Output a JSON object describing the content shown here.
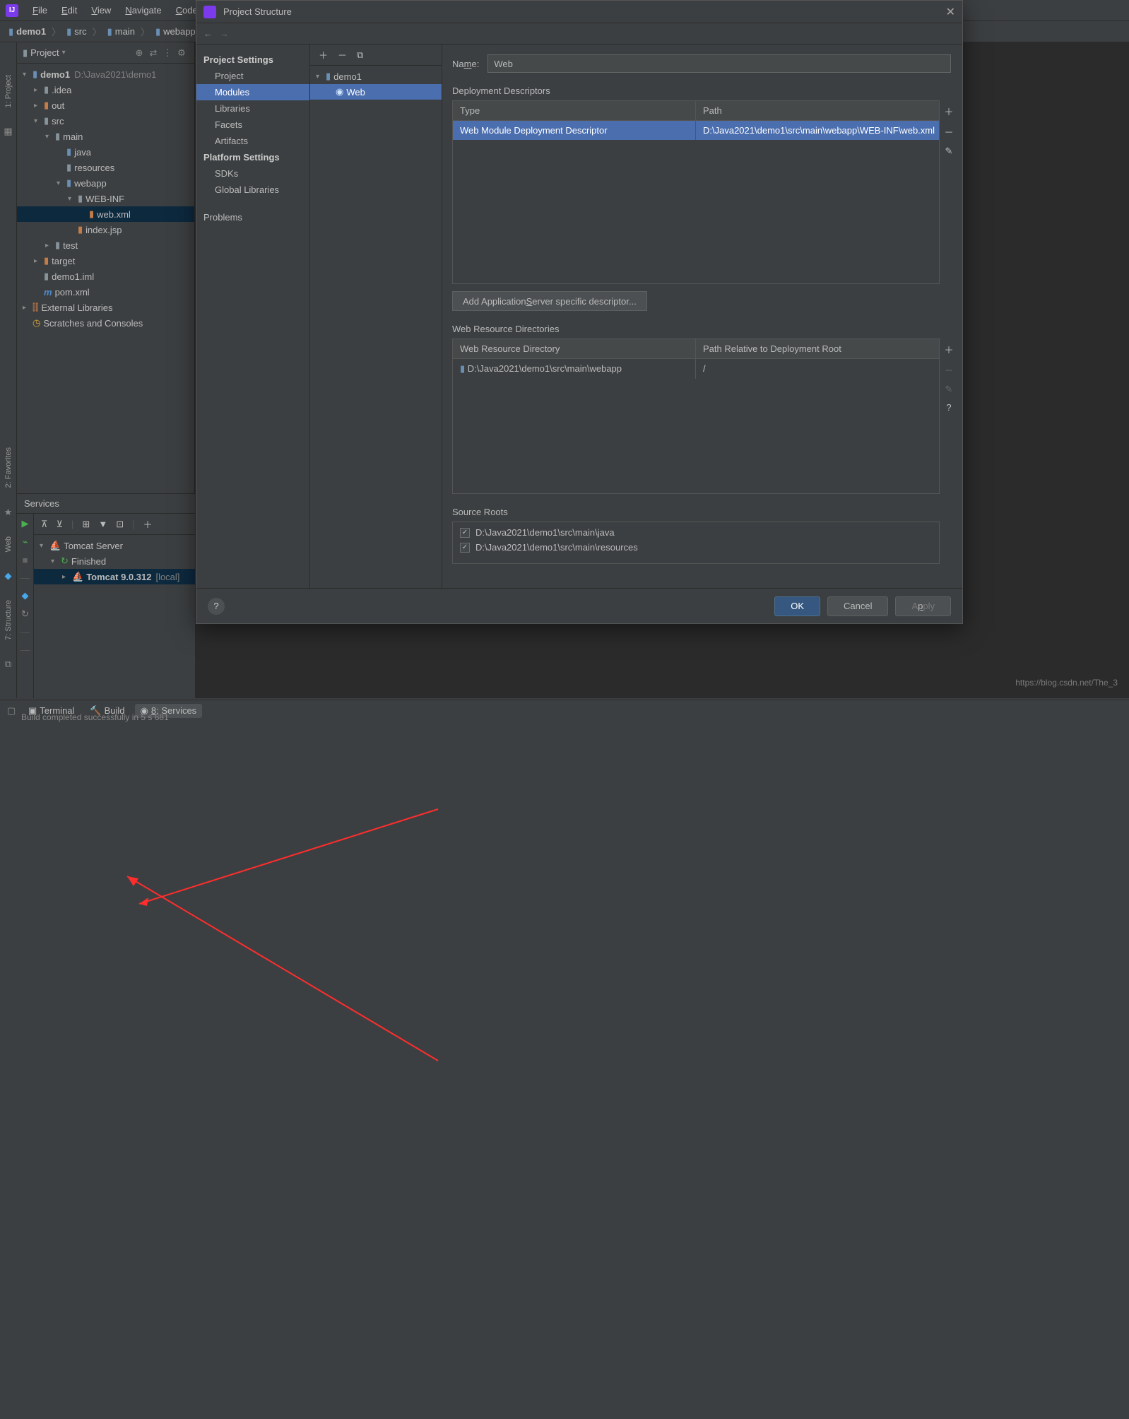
{
  "menubar": {
    "file": "File",
    "edit": "Edit",
    "view": "View",
    "navigate": "Navigate",
    "code": "Code"
  },
  "breadcrumbs": {
    "project": "demo1",
    "b1": "src",
    "b2": "main",
    "b3": "webapp"
  },
  "project_panel": {
    "title": "Project",
    "root_name": "demo1",
    "root_path": "D:\\Java2021\\demo1",
    "idea": ".idea",
    "out": "out",
    "src": "src",
    "main": "main",
    "java": "java",
    "resources": "resources",
    "webapp": "webapp",
    "webinf": "WEB-INF",
    "webxml": "web.xml",
    "indexjsp": "index.jsp",
    "test": "test",
    "target": "target",
    "iml": "demo1.iml",
    "pom": "pom.xml",
    "ext": "External Libraries",
    "scratches": "Scratches and Consoles"
  },
  "gutter": {
    "project": "1: Project",
    "favorites": "2: Favorites",
    "web": "Web",
    "structure": "7: Structure"
  },
  "services": {
    "title": "Services",
    "root": "Tomcat Server",
    "finished": "Finished",
    "run": "Tomcat 9.0.312",
    "run_suffix": "[local]"
  },
  "status_tabs": {
    "terminal": "Terminal",
    "build": "Build",
    "services": "8: Services"
  },
  "bottom_msg": "Build completed successfully in 5 s 681",
  "dialog": {
    "title": "Project Structure",
    "sidebar": {
      "project_settings": "Project Settings",
      "project": "Project",
      "modules": "Modules",
      "libraries": "Libraries",
      "facets": "Facets",
      "artifacts": "Artifacts",
      "platform_settings": "Platform Settings",
      "sdks": "SDKs",
      "global_libraries": "Global Libraries",
      "problems": "Problems"
    },
    "mid": {
      "root": "demo1",
      "web": "Web"
    },
    "right": {
      "name_label": "Name:",
      "name_value": "Web",
      "dd_title": "Deployment Descriptors",
      "dd_head_type": "Type",
      "dd_head_path": "Path",
      "dd_row_type": "Web Module Deployment Descriptor",
      "dd_row_path": "D:\\Java2021\\demo1\\src\\main\\webapp\\WEB-INF\\web.xml",
      "add_server_btn": "Add Application Server specific descriptor...",
      "wr_title": "Web Resource Directories",
      "wr_head_dir": "Web Resource Directory",
      "wr_head_rel": "Path Relative to Deployment Root",
      "wr_row_dir": "D:\\Java2021\\demo1\\src\\main\\webapp",
      "wr_row_rel": "/",
      "sr_title": "Source Roots",
      "sr_row1": "D:\\Java2021\\demo1\\src\\main\\java",
      "sr_row2": "D:\\Java2021\\demo1\\src\\main\\resources"
    },
    "footer": {
      "ok": "OK",
      "cancel": "Cancel",
      "apply": "Apply"
    }
  },
  "watermark": "https://blog.csdn.net/The_3"
}
